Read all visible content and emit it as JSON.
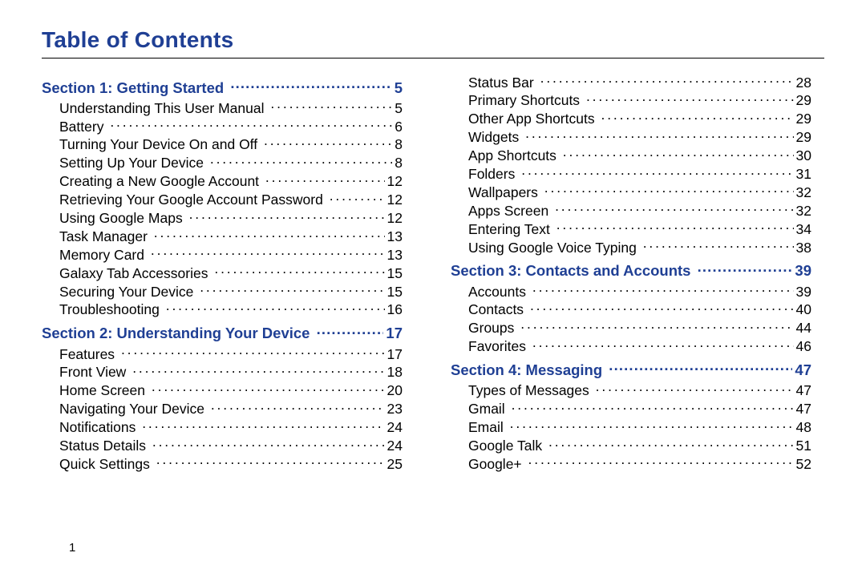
{
  "heading": "Table of Contents",
  "footer_page": "1",
  "columns": [
    [
      {
        "kind": "section",
        "label": "Section 1:  Getting Started",
        "page": "5"
      },
      {
        "kind": "item",
        "label": "Understanding This User Manual",
        "page": "5"
      },
      {
        "kind": "item",
        "label": "Battery",
        "page": "6"
      },
      {
        "kind": "item",
        "label": "Turning Your Device On and Off",
        "page": "8"
      },
      {
        "kind": "item",
        "label": "Setting Up Your Device",
        "page": "8"
      },
      {
        "kind": "item",
        "label": "Creating a New Google Account",
        "page": "12"
      },
      {
        "kind": "item",
        "label": "Retrieving Your Google Account Password",
        "page": "12"
      },
      {
        "kind": "item",
        "label": "Using Google Maps",
        "page": "12"
      },
      {
        "kind": "item",
        "label": "Task Manager",
        "page": "13"
      },
      {
        "kind": "item",
        "label": "Memory Card",
        "page": "13"
      },
      {
        "kind": "item",
        "label": "Galaxy Tab Accessories",
        "page": "15"
      },
      {
        "kind": "item",
        "label": "Securing Your Device",
        "page": "15"
      },
      {
        "kind": "item",
        "label": "Troubleshooting",
        "page": "16"
      },
      {
        "kind": "section",
        "label": "Section 2:  Understanding Your Device",
        "page": "17"
      },
      {
        "kind": "item",
        "label": "Features",
        "page": "17"
      },
      {
        "kind": "item",
        "label": "Front View",
        "page": "18"
      },
      {
        "kind": "item",
        "label": "Home Screen",
        "page": "20"
      },
      {
        "kind": "item",
        "label": "Navigating Your Device",
        "page": "23"
      },
      {
        "kind": "item",
        "label": "Notifications",
        "page": "24"
      },
      {
        "kind": "item",
        "label": "Status Details",
        "page": "24"
      },
      {
        "kind": "item",
        "label": "Quick Settings",
        "page": "25"
      }
    ],
    [
      {
        "kind": "item",
        "label": "Status Bar",
        "page": "28"
      },
      {
        "kind": "item",
        "label": "Primary Shortcuts",
        "page": "29"
      },
      {
        "kind": "item",
        "label": "Other App Shortcuts",
        "page": "29"
      },
      {
        "kind": "item",
        "label": "Widgets",
        "page": "29"
      },
      {
        "kind": "item",
        "label": "App Shortcuts",
        "page": "30"
      },
      {
        "kind": "item",
        "label": "Folders",
        "page": "31"
      },
      {
        "kind": "item",
        "label": "Wallpapers",
        "page": "32"
      },
      {
        "kind": "item",
        "label": "Apps Screen",
        "page": "32"
      },
      {
        "kind": "item",
        "label": "Entering Text",
        "page": "34"
      },
      {
        "kind": "item",
        "label": "Using Google Voice Typing",
        "page": "38"
      },
      {
        "kind": "section",
        "label": "Section 3:  Contacts and Accounts",
        "page": "39"
      },
      {
        "kind": "item",
        "label": "Accounts",
        "page": "39"
      },
      {
        "kind": "item",
        "label": "Contacts",
        "page": "40"
      },
      {
        "kind": "item",
        "label": "Groups",
        "page": "44"
      },
      {
        "kind": "item",
        "label": "Favorites",
        "page": "46"
      },
      {
        "kind": "section",
        "label": "Section 4:  Messaging",
        "page": "47"
      },
      {
        "kind": "item",
        "label": "Types of Messages",
        "page": "47"
      },
      {
        "kind": "item",
        "label": "Gmail",
        "page": "47"
      },
      {
        "kind": "item",
        "label": "Email",
        "page": "48"
      },
      {
        "kind": "item",
        "label": "Google Talk",
        "page": "51"
      },
      {
        "kind": "item",
        "label": "Google+",
        "page": "52"
      }
    ]
  ]
}
